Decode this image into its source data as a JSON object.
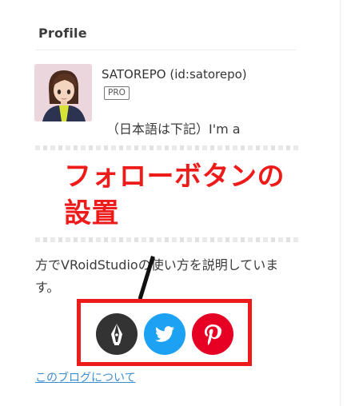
{
  "module": {
    "title": "Profile"
  },
  "profile": {
    "username": "SATOREPO (id:satorepo)",
    "badge": "PRO",
    "description_line1": "（日本語は下記）I'm a",
    "description_tail": "方でVRoidStudioの使い方を説明しています。"
  },
  "annotation": {
    "label_line1": "フォローボタンの",
    "label_line2": "設置",
    "color": "#ee1b1b"
  },
  "follow_buttons": [
    {
      "name": "hatena-follow-button",
      "icon": "hatena-pen-icon",
      "color": "#333333"
    },
    {
      "name": "twitter-follow-button",
      "icon": "twitter-bird-icon",
      "color": "#1da1f2"
    },
    {
      "name": "pinterest-follow-button",
      "icon": "pinterest-icon",
      "color": "#e60023"
    }
  ],
  "links": {
    "about_blog": "このブログについて"
  }
}
